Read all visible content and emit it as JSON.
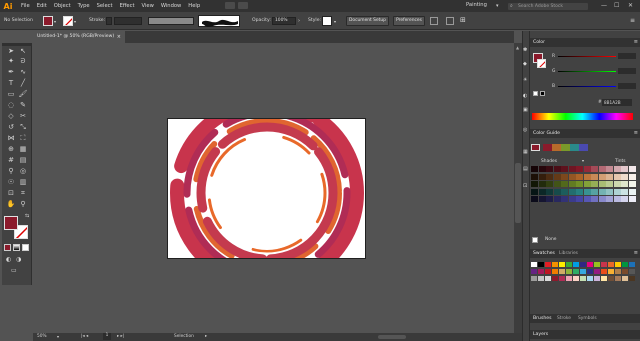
{
  "app": {
    "logo": "Ai",
    "workspace": "Painting",
    "search_placeholder": "Search Adobe Stock"
  },
  "menu": [
    "File",
    "Edit",
    "Object",
    "Type",
    "Select",
    "Effect",
    "View",
    "Window",
    "Help"
  ],
  "window_controls": [
    "—",
    "☐",
    "✕"
  ],
  "control": {
    "selection_label": "No Selection",
    "stroke_label": "Stroke:",
    "opacity_label": "Opacity:",
    "opacity_value": "100%",
    "style_label": "Style:",
    "document_setup": "Document Setup",
    "preferences": "Preferences",
    "fill_color": "#8b1a2b"
  },
  "document": {
    "tab_title": "Untitled-1* @ 50% (RGB/Preview)",
    "close": "×"
  },
  "status": {
    "zoom": "50%",
    "page": "1",
    "tool": "Selection"
  },
  "colors": {
    "accent": "#c8344c",
    "orange": "#e8692a",
    "panel": "#424242"
  },
  "panels": {
    "color": {
      "title": "Color",
      "channels": [
        "R",
        "G",
        "B"
      ],
      "hex_label": "#",
      "hex_value": "8B1A2B"
    },
    "color_guide": {
      "title": "Color Guide",
      "left": "Shades",
      "right": "Tints",
      "none_label": "None"
    },
    "swatches": {
      "title": "Swatches",
      "tab2": "Libraries"
    },
    "brushes": {
      "title": "Brushes",
      "tab2": "Stroke",
      "tab3": "Symbols"
    },
    "layers": {
      "title": "Layers"
    }
  },
  "tools": [
    "selection-tool",
    "direct-selection-tool",
    "magic-wand-tool",
    "lasso-tool",
    "pen-tool",
    "curvature-tool",
    "type-tool",
    "line-tool",
    "rectangle-tool",
    "paintbrush-tool",
    "shaper-tool",
    "pencil-tool",
    "eraser-tool",
    "scissors-tool",
    "rotate-tool",
    "scale-tool",
    "width-tool",
    "free-transform-tool",
    "shape-builder-tool",
    "perspective-grid-tool",
    "mesh-tool",
    "gradient-tool",
    "eyedropper-tool",
    "blend-tool",
    "symbol-sprayer-tool",
    "column-graph-tool",
    "artboard-tool",
    "slice-tool",
    "hand-tool",
    "zoom-tool"
  ]
}
